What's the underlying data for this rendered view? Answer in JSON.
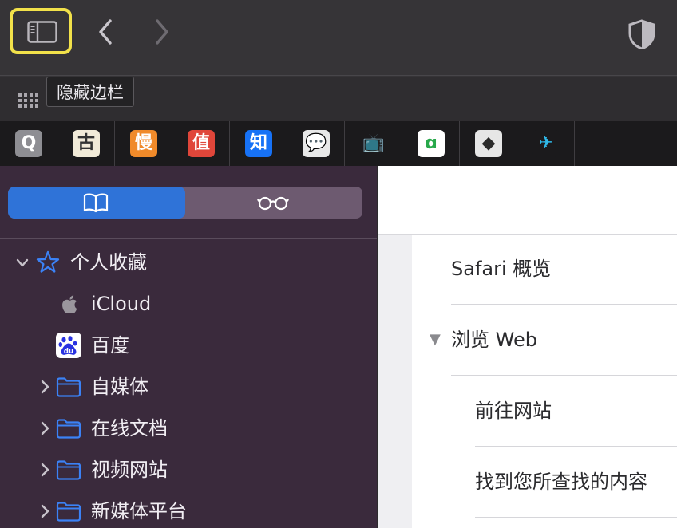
{
  "toolbar": {
    "sidebar_toggle_icon": "sidebar-icon",
    "back_icon": "chevron-left-icon",
    "forward_icon": "chevron-right-icon",
    "privacy_icon": "shield-icon",
    "highlight_color": "#f2e14a"
  },
  "tooltip": {
    "text": "隐藏边栏"
  },
  "favorites_grid_icon": "grid-icon",
  "tabs": [
    {
      "name": "q-site",
      "glyph": "Q",
      "bg": "#8e8e93",
      "fg": "#ffffff"
    },
    {
      "name": "gu-site",
      "glyph": "古",
      "bg": "#f1ead8",
      "fg": "#333333"
    },
    {
      "name": "man-site",
      "glyph": "慢",
      "bg": "#f08a2a",
      "fg": "#ffffff"
    },
    {
      "name": "zhi-deal-site",
      "glyph": "值",
      "bg": "#e0463a",
      "fg": "#ffffff"
    },
    {
      "name": "zhihu-site",
      "glyph": "知",
      "bg": "#1772f6",
      "fg": "#ffffff"
    },
    {
      "name": "wechat-site",
      "glyph": "💬",
      "bg": "#e8e8e8",
      "fg": "#333333"
    },
    {
      "name": "bilibili-site",
      "glyph": "📺",
      "bg": "#1b1a1c",
      "fg": "#1fa3df"
    },
    {
      "name": "green-site",
      "glyph": "ɑ",
      "bg": "#ffffff",
      "fg": "#27a84a"
    },
    {
      "name": "dark-pin-site",
      "glyph": "◆",
      "bg": "#e6e6e6",
      "fg": "#2a2a2a"
    },
    {
      "name": "send-site",
      "glyph": "✈",
      "bg": "#1b1a1c",
      "fg": "#2fb8e8"
    }
  ],
  "sidebar": {
    "segments": [
      {
        "name": "bookmarks",
        "icon": "book-icon",
        "selected": true
      },
      {
        "name": "reading-list",
        "icon": "glasses-icon",
        "selected": false
      }
    ],
    "accent": "#2f73d8",
    "favorites": {
      "label": "个人收藏",
      "icon": "star-icon",
      "expanded": true
    },
    "items": [
      {
        "label": "iCloud",
        "icon": "apple-icon",
        "folder": false
      },
      {
        "label": "百度",
        "icon": "baidu-icon",
        "folder": false
      },
      {
        "label": "自媒体",
        "icon": "folder-icon",
        "folder": true
      },
      {
        "label": "在线文档",
        "icon": "folder-icon",
        "folder": true
      },
      {
        "label": "视频网站",
        "icon": "folder-icon",
        "folder": true
      },
      {
        "label": "新媒体平台",
        "icon": "folder-icon",
        "folder": true
      }
    ]
  },
  "content": {
    "toc": [
      {
        "text": "Safari 概览",
        "level": 0,
        "expandable": false
      },
      {
        "text": "浏览 Web",
        "level": 0,
        "expandable": true
      },
      {
        "text": "前往网站",
        "level": 1,
        "expandable": false
      },
      {
        "text": "找到您所查找的内容",
        "level": 1,
        "expandable": false
      }
    ]
  }
}
